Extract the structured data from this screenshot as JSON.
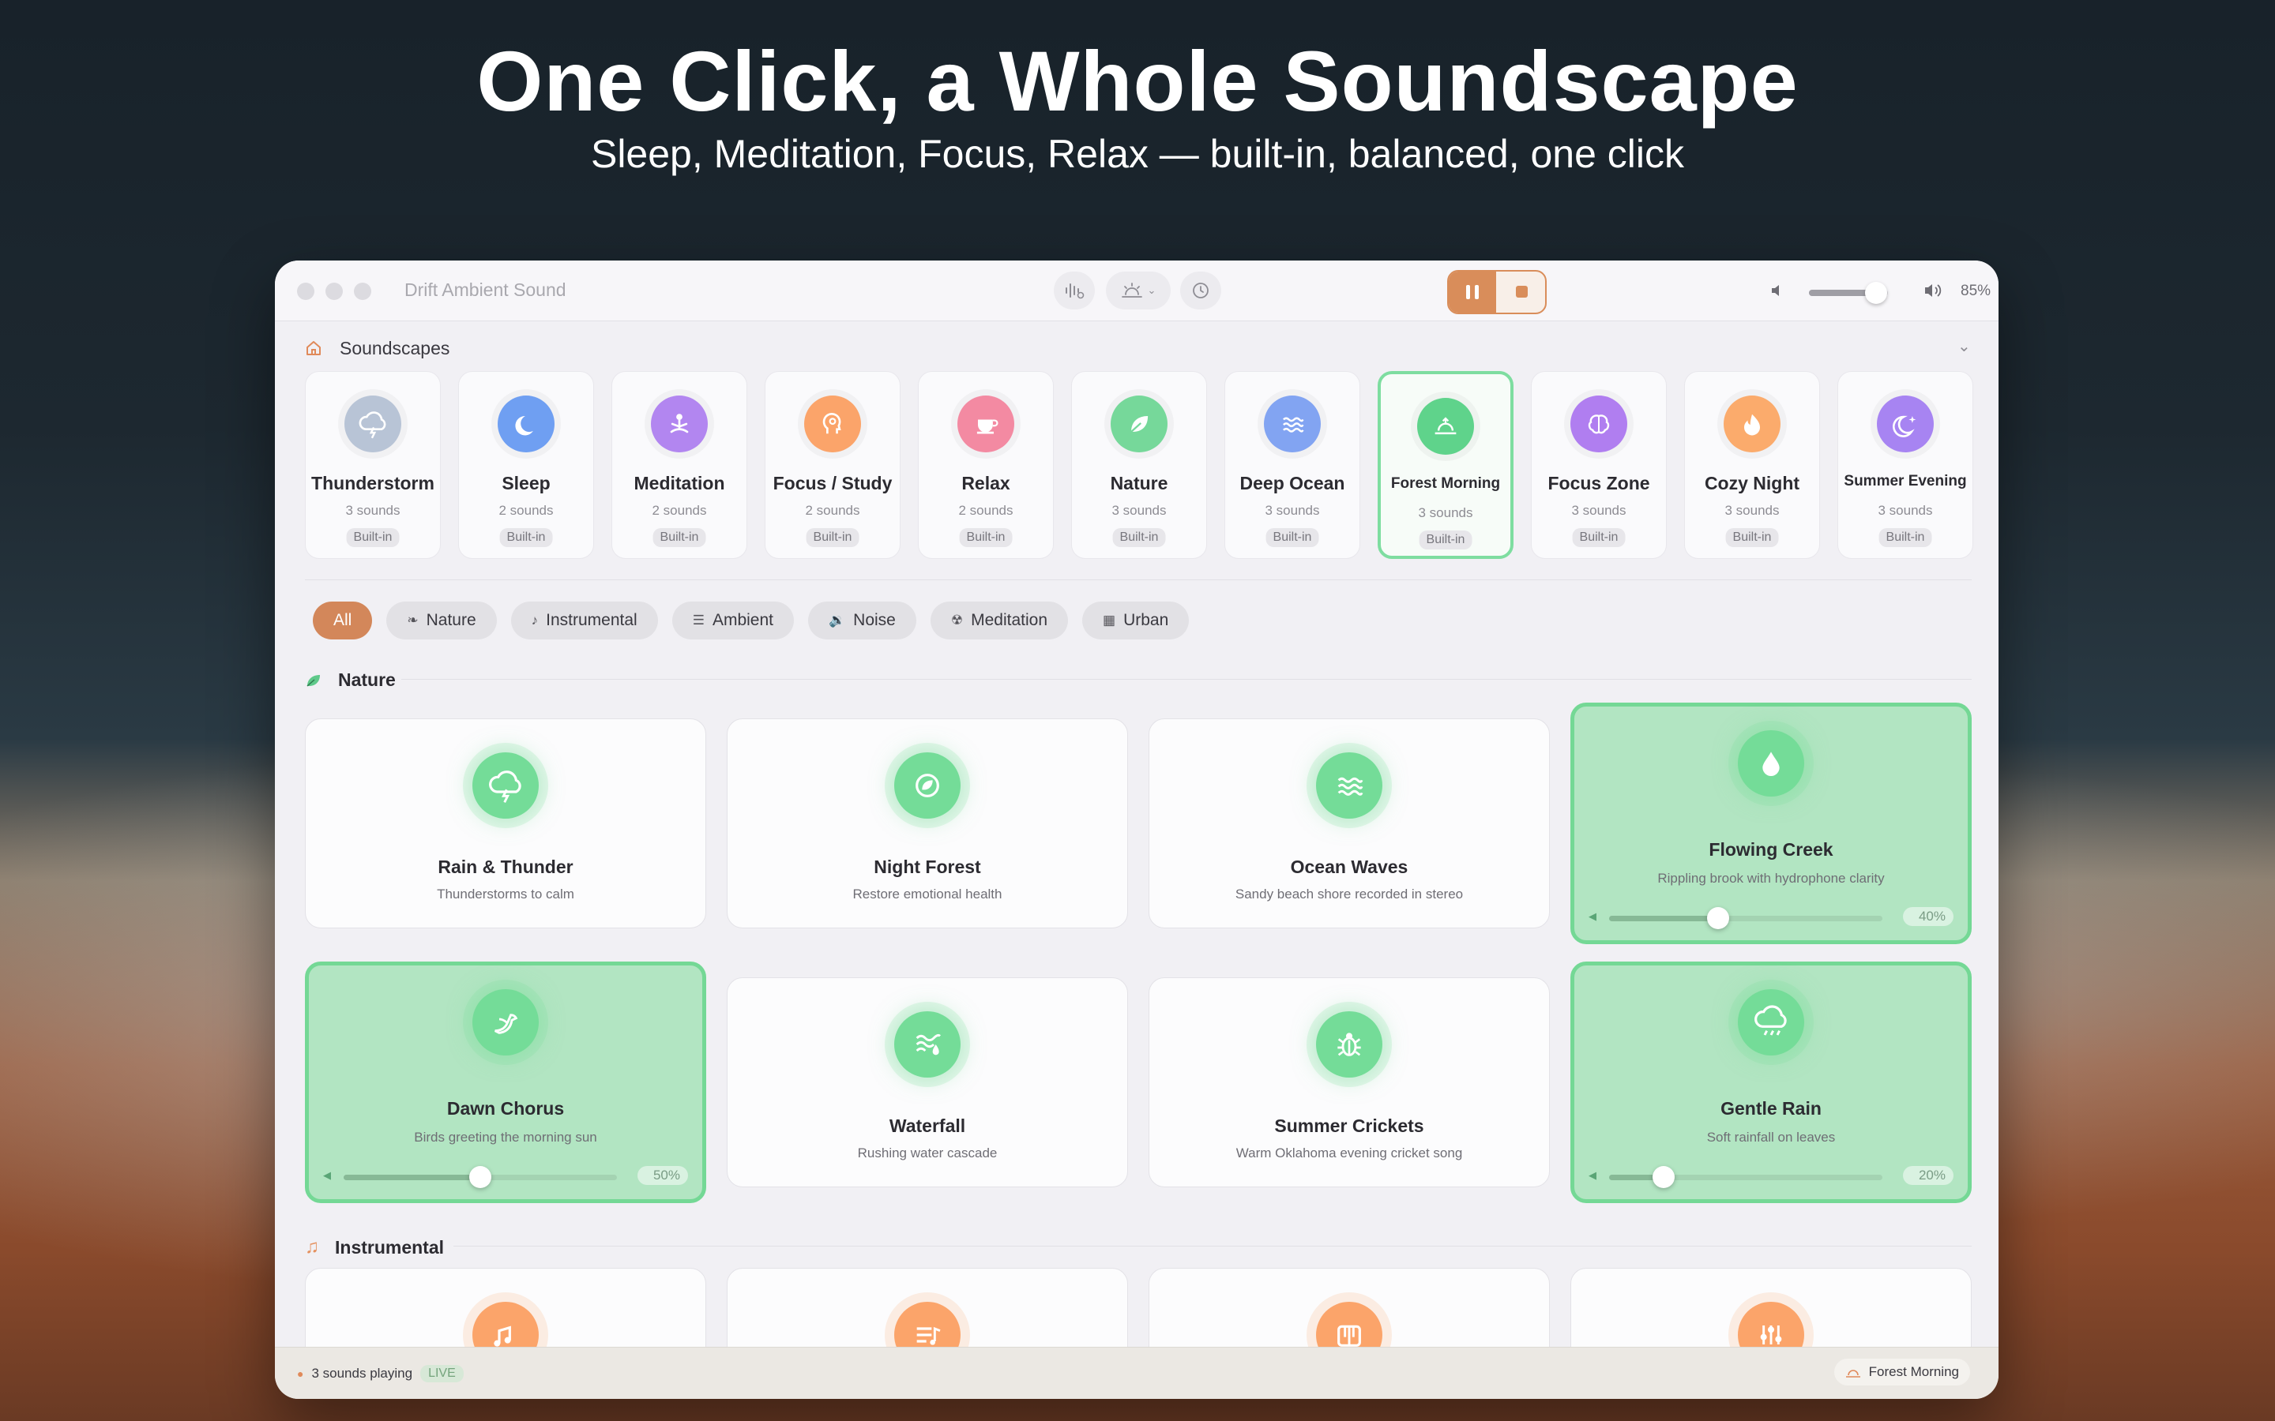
{
  "hero": {
    "title": "One Click, a Whole Soundscape",
    "subtitle": "Sleep, Meditation, Focus, Relax — built-in, balanced, one click"
  },
  "window": {
    "app_title": "Drift Ambient Sound",
    "volume_percent": "85%",
    "volume_level": 0.85
  },
  "soundscapes": {
    "section_title": "Soundscapes",
    "items": [
      {
        "name": "Thunderstorm",
        "count": "3 sounds",
        "badge": "Built-in",
        "icon": "cloud-lightning-icon",
        "color": "#b8c4d6"
      },
      {
        "name": "Sleep",
        "count": "2 sounds",
        "badge": "Built-in",
        "icon": "moon-icon",
        "color": "#6f9ff2"
      },
      {
        "name": "Meditation",
        "count": "2 sounds",
        "badge": "Built-in",
        "icon": "meditation-icon",
        "color": "#b286f0"
      },
      {
        "name": "Focus / Study",
        "count": "2 sounds",
        "badge": "Built-in",
        "icon": "head-icon",
        "color": "#fba46a"
      },
      {
        "name": "Relax",
        "count": "2 sounds",
        "badge": "Built-in",
        "icon": "cup-icon",
        "color": "#f38aa2"
      },
      {
        "name": "Nature",
        "count": "3 sounds",
        "badge": "Built-in",
        "icon": "leaf-icon",
        "color": "#76d89a"
      },
      {
        "name": "Deep Ocean",
        "count": "3 sounds",
        "badge": "Built-in",
        "icon": "waves-icon",
        "color": "#82a4f2"
      },
      {
        "name": "Forest Morning",
        "count": "3 sounds",
        "badge": "Built-in",
        "icon": "sunrise-icon",
        "color": "#5fd38b",
        "active": true
      },
      {
        "name": "Focus Zone",
        "count": "3 sounds",
        "badge": "Built-in",
        "icon": "brain-icon",
        "color": "#b07ef0"
      },
      {
        "name": "Cozy Night",
        "count": "3 sounds",
        "badge": "Built-in",
        "icon": "flame-icon",
        "color": "#fbab6c"
      },
      {
        "name": "Summer Evening",
        "count": "3 sounds",
        "badge": "Built-in",
        "icon": "moon-star-icon",
        "color": "#a784f2"
      }
    ]
  },
  "filters": [
    {
      "label": "All",
      "active": true
    },
    {
      "label": "Nature",
      "icon": "leaf-icon"
    },
    {
      "label": "Instrumental",
      "icon": "music-note-icon"
    },
    {
      "label": "Ambient",
      "icon": "waveform-icon"
    },
    {
      "label": "Noise",
      "icon": "speaker-icon"
    },
    {
      "label": "Meditation",
      "icon": "meditation-icon"
    },
    {
      "label": "Urban",
      "icon": "building-icon"
    }
  ],
  "nature": {
    "title": "Nature",
    "cards": [
      {
        "name": "Rain & Thunder",
        "desc": "Thunderstorms to calm",
        "icon": "cloud-lightning-icon"
      },
      {
        "name": "Night Forest",
        "desc": "Restore emotional health",
        "icon": "circle-leaf-icon"
      },
      {
        "name": "Ocean Waves",
        "desc": "Sandy beach shore recorded in stereo",
        "icon": "waves-icon"
      },
      {
        "name": "Flowing Creek",
        "desc": "Rippling brook with hydrophone clarity",
        "icon": "droplet-icon",
        "active": true,
        "level": 0.4,
        "level_label": "40%"
      },
      {
        "name": "Dawn Chorus",
        "desc": "Birds greeting the morning sun",
        "icon": "bird-icon",
        "active": true,
        "level": 0.5,
        "level_label": "50%"
      },
      {
        "name": "Waterfall",
        "desc": "Rushing water cascade",
        "icon": "waterfall-icon"
      },
      {
        "name": "Summer Crickets",
        "desc": "Warm Oklahoma evening cricket song",
        "icon": "bug-icon"
      },
      {
        "name": "Gentle Rain",
        "desc": "Soft rainfall on leaves",
        "icon": "cloud-rain-icon",
        "active": true,
        "level": 0.2,
        "level_label": "20%"
      }
    ]
  },
  "instrumental": {
    "title": "Instrumental",
    "cards": [
      {
        "icon": "music-sleep-icon"
      },
      {
        "icon": "playlist-icon"
      },
      {
        "icon": "piano-icon"
      },
      {
        "icon": "equalizer-icon"
      }
    ]
  },
  "status": {
    "playing": "3 sounds playing",
    "live": "LIVE",
    "current": "Forest Morning"
  }
}
